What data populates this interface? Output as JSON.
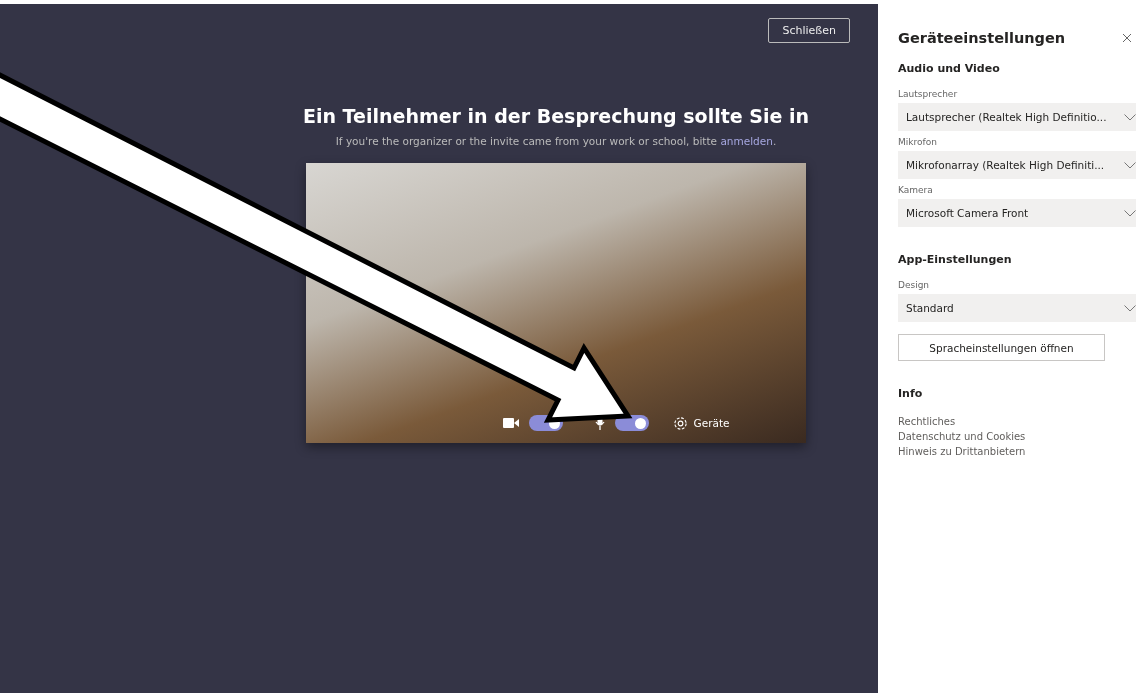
{
  "main": {
    "close_button": "Schließen",
    "heading": "Ein Teilnehmer in der Besprechung sollte Sie in",
    "subtitle": {
      "text": "If you're the organizer or the invite came from your work or school, bitte",
      "link": "anmelden",
      "end": "."
    },
    "video": {
      "camera_on": true,
      "mic_on": true,
      "devices_label": "Geräte"
    }
  },
  "panel": {
    "title": "Geräteeinstellungen",
    "sections": [
      {
        "heading": "Audio und Video",
        "dropdowns": [
          {
            "label": "Lautsprecher",
            "value": "Lautsprecher (Realtek High Definitio..."
          },
          {
            "label": "Mikrofon",
            "value": "Mikrofonarray (Realtek High Definiti..."
          },
          {
            "label": "Kamera",
            "value": "Microsoft Camera Front"
          }
        ]
      },
      {
        "heading": "App-Einstellungen",
        "dropdowns": [
          {
            "label": "Design",
            "value": "Standard"
          }
        ],
        "button": "Spracheinstellungen öffnen"
      },
      {
        "heading": "Info",
        "links": [
          "Rechtliches",
          "Datenschutz und Cookies",
          "Hinweis zu Drittanbietern"
        ]
      }
    ]
  }
}
